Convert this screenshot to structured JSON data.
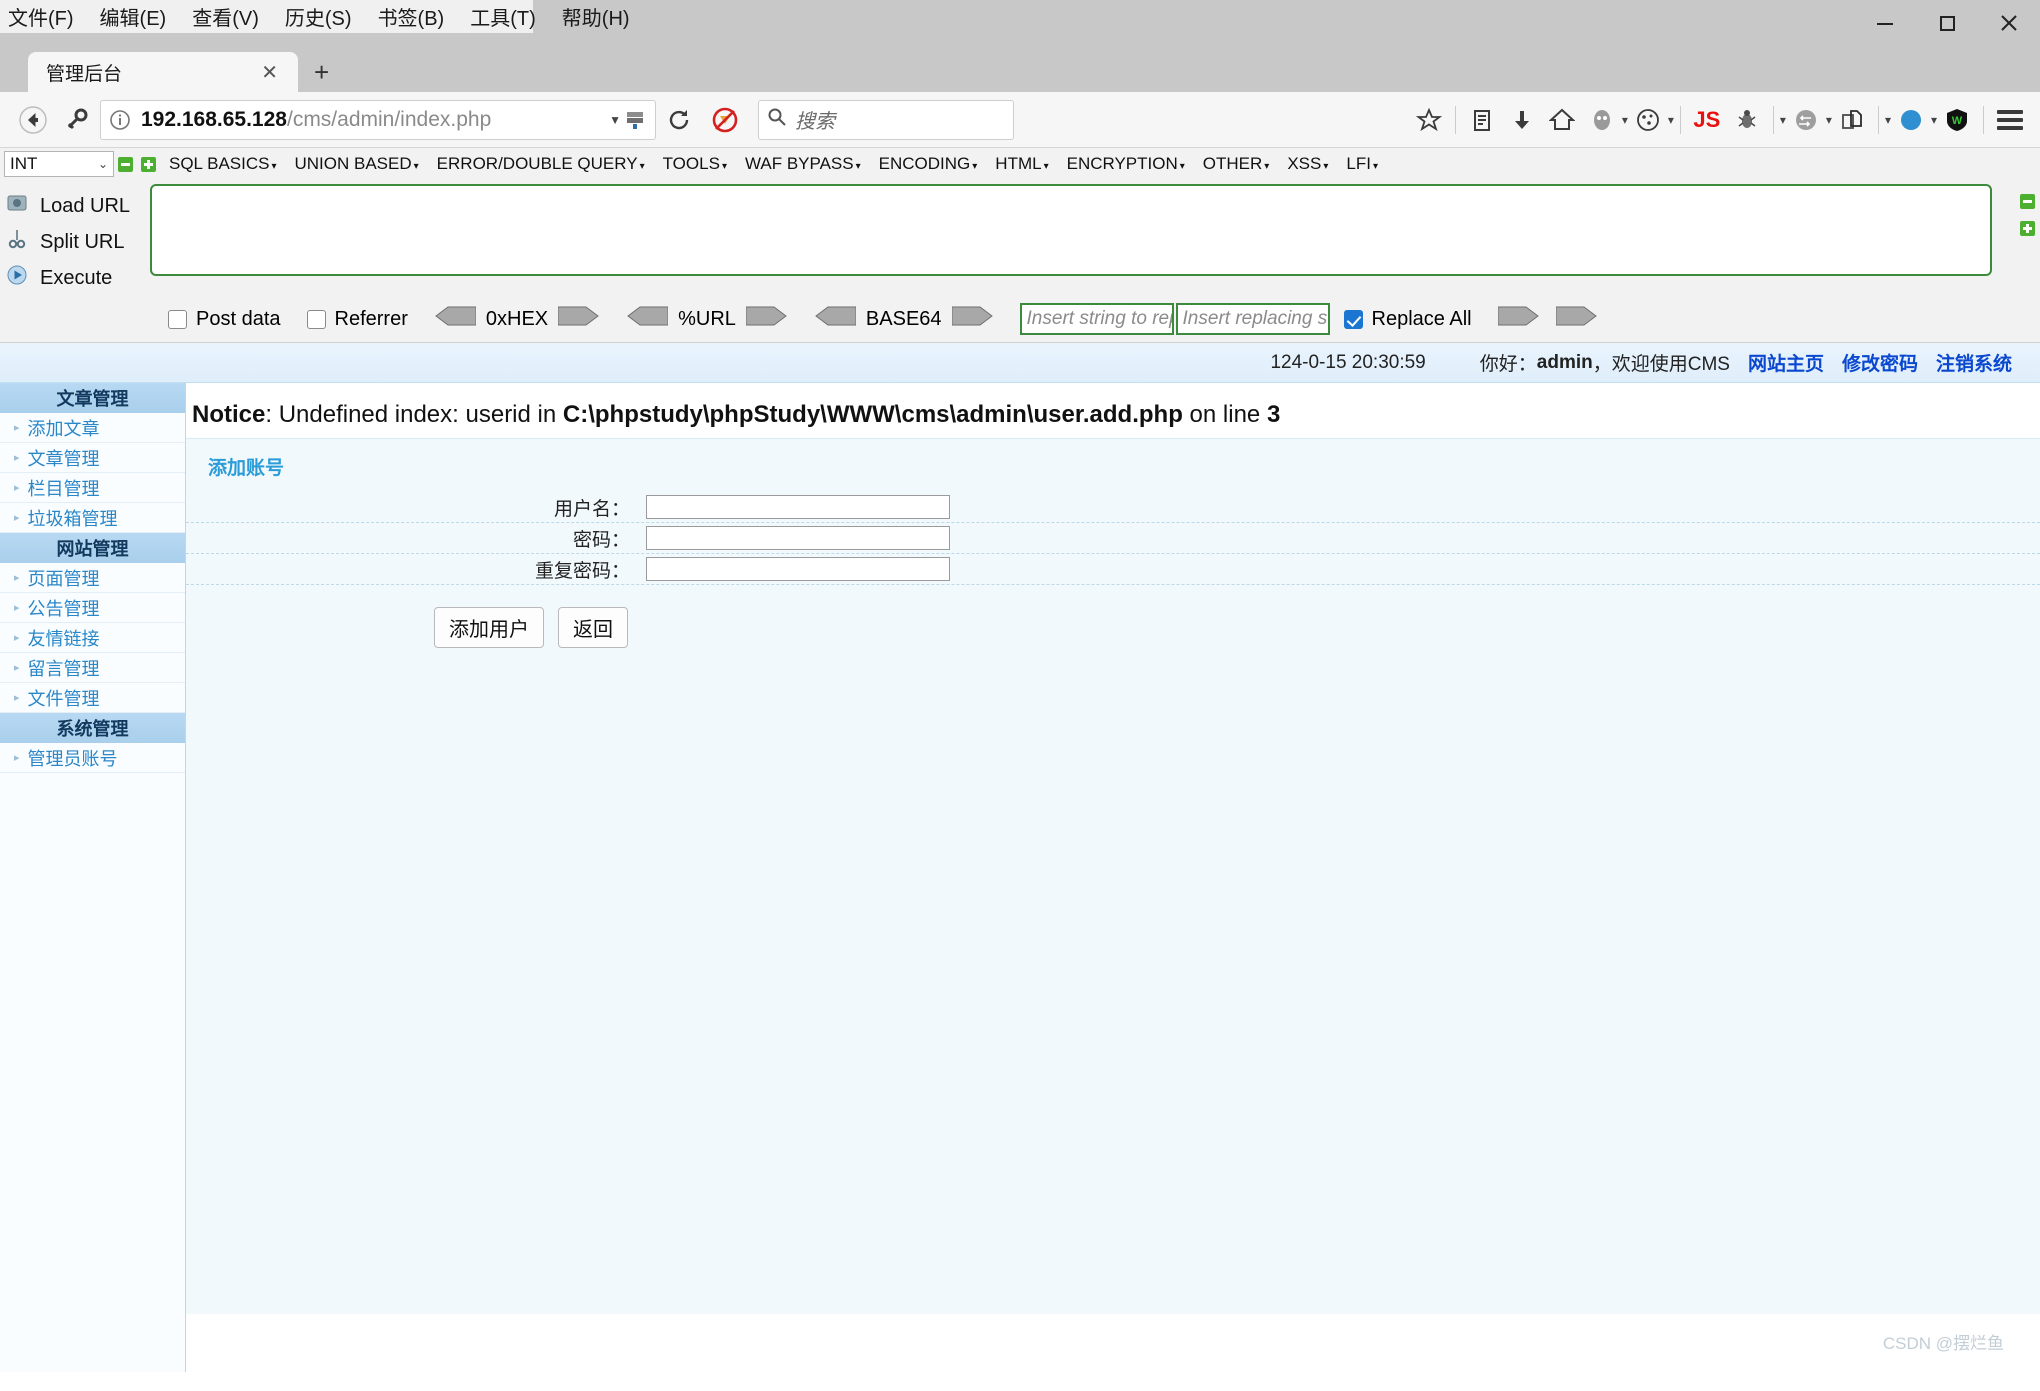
{
  "window": {
    "menus": [
      "文件(F)",
      "编辑(E)",
      "查看(V)",
      "历史(S)",
      "书签(B)",
      "工具(T)",
      "帮助(H)"
    ],
    "minimize": "—",
    "maximize": "□",
    "close": "✕"
  },
  "tabs": {
    "items": [
      {
        "title": "管理后台",
        "close": "✕"
      }
    ],
    "new_tab": "+"
  },
  "navbar": {
    "url_host": "192.168.65.128",
    "url_path": "/cms/admin/index.php",
    "search_placeholder": "搜索",
    "js_label": "JS"
  },
  "hackbar": {
    "type_select": "INT",
    "menus": [
      "SQL BASICS",
      "UNION BASED",
      "ERROR/DOUBLE QUERY",
      "TOOLS",
      "WAF BYPASS",
      "ENCODING",
      "HTML",
      "ENCRYPTION",
      "OTHER",
      "XSS",
      "LFI"
    ],
    "actions": [
      "Load URL",
      "Split URL",
      "Execute"
    ],
    "url_textarea_value": "",
    "post_data_label": "Post data",
    "referrer_label": "Referrer",
    "encoders": [
      "0xHEX",
      "%URL",
      "BASE64"
    ],
    "replace_from_placeholder": "Insert string to replace",
    "replace_to_placeholder": "Insert replacing string",
    "replace_all_label": "Replace All"
  },
  "page": {
    "topbar": {
      "timestamp": "124-0-15 20:30:59",
      "greeting_prefix": "你好：",
      "user": "admin",
      "greeting_suffix": "，欢迎使用CMS",
      "links": [
        "网站主页",
        "修改密码",
        "注销系统"
      ]
    },
    "notice": {
      "label": "Notice",
      "middle": ": Undefined index: userid in ",
      "path": "C:\\phpstudy\\phpStudy\\WWW\\cms\\admin\\user.add.php",
      "tail": " on line ",
      "line": "3"
    },
    "sidebar": {
      "groups": [
        {
          "title": "文章管理",
          "items": [
            "添加文章",
            "文章管理",
            "栏目管理",
            "垃圾箱管理"
          ]
        },
        {
          "title": "网站管理",
          "items": [
            "页面管理",
            "公告管理",
            "友情链接",
            "留言管理",
            "文件管理"
          ]
        },
        {
          "title": "系统管理",
          "items": [
            "管理员账号"
          ]
        }
      ]
    },
    "form": {
      "title": "添加账号",
      "fields": [
        {
          "label": "用户名：",
          "value": ""
        },
        {
          "label": "密码：",
          "value": ""
        },
        {
          "label": "重复密码：",
          "value": ""
        }
      ],
      "submit_label": "添加用户",
      "back_label": "返回"
    },
    "watermark": "CSDN @摆烂鱼"
  }
}
